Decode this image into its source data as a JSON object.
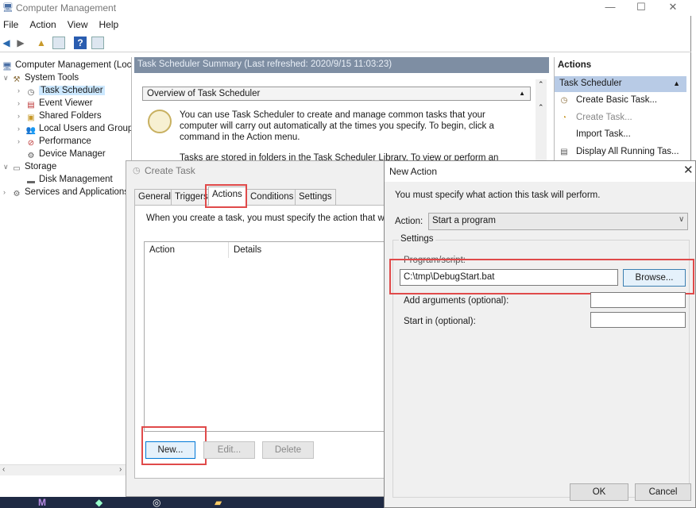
{
  "window": {
    "title": "Computer Management",
    "controls": {
      "minimize": "—",
      "maximize": "☐",
      "close": "✕"
    }
  },
  "menu": [
    "File",
    "Action",
    "View",
    "Help"
  ],
  "tree": {
    "root": "Computer Management (Local",
    "system_tools": "System Tools",
    "task_scheduler": "Task Scheduler",
    "event_viewer": "Event Viewer",
    "shared_folders": "Shared Folders",
    "local_users": "Local Users and Groups",
    "performance": "Performance",
    "device_manager": "Device Manager",
    "storage": "Storage",
    "disk_management": "Disk Management",
    "services": "Services and Applications"
  },
  "summary": {
    "header": "Task Scheduler Summary (Last refreshed: 2020/9/15 11:03:23)",
    "overview_title": "Overview of Task Scheduler",
    "overview_text": "You can use Task Scheduler to create and manage common tasks that your computer will carry out automatically at the times you specify. To begin, click a command in the Action menu.",
    "overview_text2": "Tasks are stored in folders in the Task Scheduler Library. To view or perform an"
  },
  "actions_pane": {
    "header": "Actions",
    "section": "Task Scheduler",
    "items": [
      "Create Basic Task...",
      "Create Task...",
      "Import Task...",
      "Display All Running Tas..."
    ]
  },
  "create_task": {
    "title": "Create Task",
    "tabs": [
      "General",
      "Triggers",
      "Actions",
      "Conditions",
      "Settings"
    ],
    "active_tab": "Actions",
    "description": "When you create a task, you must specify the action that will oc",
    "columns": [
      "Action",
      "Details"
    ],
    "buttons": {
      "new": "New...",
      "edit": "Edit...",
      "delete": "Delete"
    }
  },
  "new_action": {
    "title": "New Action",
    "message": "You must specify what action this task will perform.",
    "action_label": "Action:",
    "action_value": "Start a program",
    "settings_label": "Settings",
    "program_label": "Program/script:",
    "program_value": "C:\\tmp\\DebugStart.bat",
    "browse": "Browse...",
    "args_label": "Add arguments (optional):",
    "start_label": "Start in (optional):",
    "ok": "OK",
    "cancel": "Cancel"
  },
  "colors": {
    "selection": "#cce8ff",
    "summary_header": "#7e8ea3",
    "actions_section": "#b8cbe6",
    "highlight_box": "#e04a4a",
    "taskbar": "#1f2a44"
  }
}
